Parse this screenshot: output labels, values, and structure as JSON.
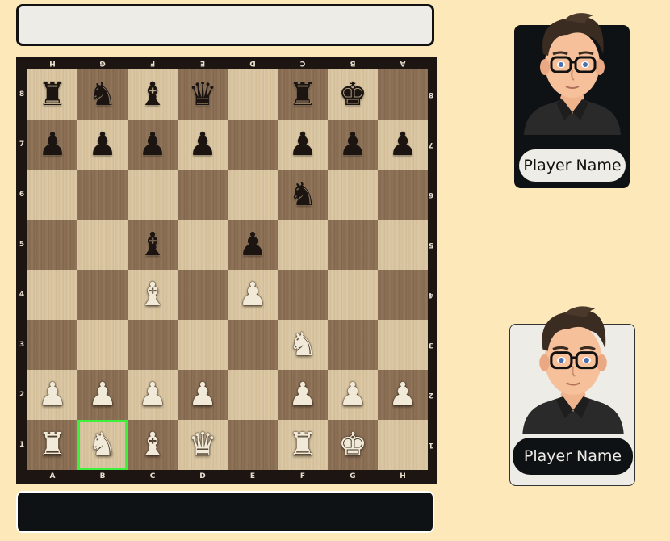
{
  "files": [
    "A",
    "B",
    "C",
    "D",
    "E",
    "F",
    "G",
    "H"
  ],
  "ranks": [
    "8",
    "7",
    "6",
    "5",
    "4",
    "3",
    "2",
    "1"
  ],
  "board": [
    [
      "bR",
      "bN",
      "bB",
      "bQ",
      "",
      "bR",
      "bK",
      ""
    ],
    [
      "bP",
      "bP",
      "bP",
      "bP",
      "",
      "bP",
      "bP",
      "bP"
    ],
    [
      "",
      "",
      "",
      "",
      "",
      "bN",
      "",
      ""
    ],
    [
      "",
      "",
      "bB",
      "",
      "bP",
      "",
      "",
      ""
    ],
    [
      "",
      "",
      "wB",
      "",
      "wP",
      "",
      "",
      ""
    ],
    [
      "",
      "",
      "",
      "",
      "",
      "wN",
      "",
      ""
    ],
    [
      "wP",
      "wP",
      "wP",
      "wP",
      "",
      "wP",
      "wP",
      "wP"
    ],
    [
      "wR",
      "wN",
      "wB",
      "wQ",
      "",
      "wR",
      "wK",
      ""
    ]
  ],
  "highlight_square": "B1",
  "highlight_color": "#3cf03c",
  "piece_glyphs": {
    "bK": "♚",
    "bQ": "♛",
    "bR": "♜",
    "bB": "♝",
    "bN": "♞",
    "bP": "♟",
    "wK": "♚",
    "wQ": "♛",
    "wR": "♜",
    "wB": "♝",
    "wN": "♞",
    "wP": "♟"
  },
  "piece_names": {
    "K": "king",
    "Q": "queen",
    "R": "rook",
    "B": "bishop",
    "N": "knight",
    "P": "pawn"
  },
  "top_player": {
    "name": "Player Name",
    "avatar_icon": "avatar-icon"
  },
  "bottom_player": {
    "name": "Player Name",
    "avatar_icon": "avatar-icon"
  },
  "colors": {
    "background": "#fde8b9",
    "dark_panel": "#0e1214",
    "light_panel": "#eeece6"
  }
}
